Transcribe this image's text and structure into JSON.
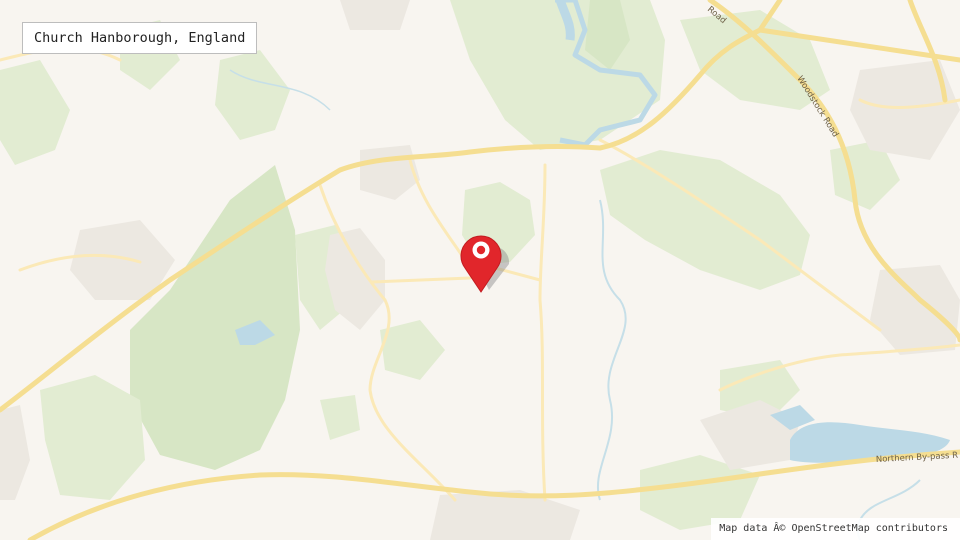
{
  "map": {
    "title": "Church Hanborough, England",
    "attribution": "Map data Â© OpenStreetMap contributors",
    "road_labels": {
      "top": "Road",
      "woodstock": "Woodstock Road",
      "bypass": "Northern By-pass R"
    },
    "marker_icon": "map-pin-icon",
    "colors": {
      "land": "#f8f5f0",
      "wood": "#e2ecd2",
      "wood_dark": "#d7e6c5",
      "water": "#bcd9e6",
      "major_road": "#f5de91",
      "minor_road": "#fbe9b7",
      "built": "#ece8e1",
      "marker": "#e1262b"
    }
  }
}
